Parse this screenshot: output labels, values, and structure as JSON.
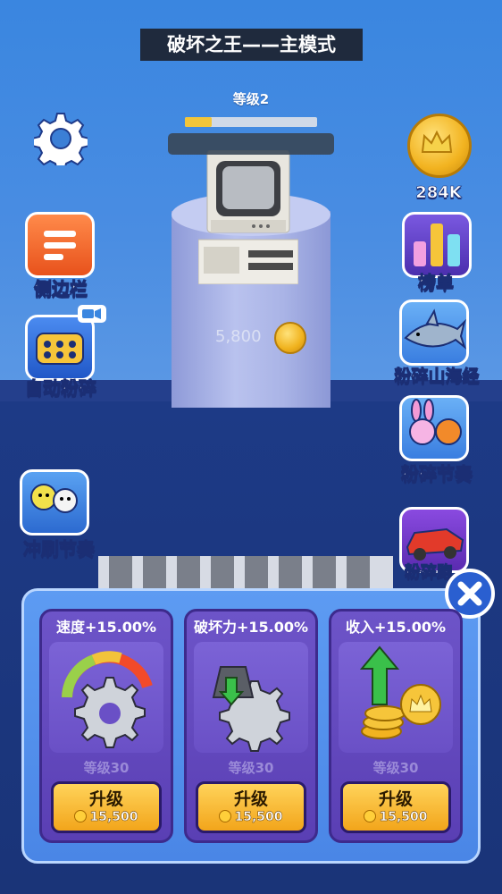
{
  "header": {
    "title": "破坏之王——主模式"
  },
  "level": {
    "label": "等级2",
    "progress": 0.2
  },
  "target": {
    "price": "5,800"
  },
  "coins": {
    "amount": "284K"
  },
  "left_buttons": [
    {
      "label": "侧边栏",
      "icon": "menu-list-icon",
      "color": "#f06a2a"
    },
    {
      "label": "自动粉碎",
      "icon": "auto-shred-icon",
      "color": "#2f68d6"
    },
    {
      "label": "冲刷节奏",
      "icon": "cartoon-characters-icon",
      "color": "#3b8ce0"
    }
  ],
  "right_buttons": [
    {
      "label": "榜单",
      "icon": "leaderboard-icon",
      "color": "#5b3ec0"
    },
    {
      "label": "粉碎山海经",
      "icon": "shark-icon",
      "color": "#3a7ee0"
    },
    {
      "label": "粉碎节奏",
      "icon": "bunny-characters-icon",
      "color": "#3a7ee0"
    },
    {
      "label": "粉碎跑",
      "icon": "race-car-icon",
      "color": "#6a3ab4"
    }
  ],
  "upgrades": [
    {
      "title": "速度+15.00%",
      "icon": "speedometer-gear-icon",
      "level": "等级30",
      "button": "升级",
      "cost": "15,500"
    },
    {
      "title": "破坏力+15.00%",
      "icon": "weight-gear-icon",
      "level": "等级30",
      "button": "升级",
      "cost": "15,500"
    },
    {
      "title": "收入+15.00%",
      "icon": "coins-arrow-icon",
      "level": "等级30",
      "button": "升级",
      "cost": "15,500"
    }
  ]
}
